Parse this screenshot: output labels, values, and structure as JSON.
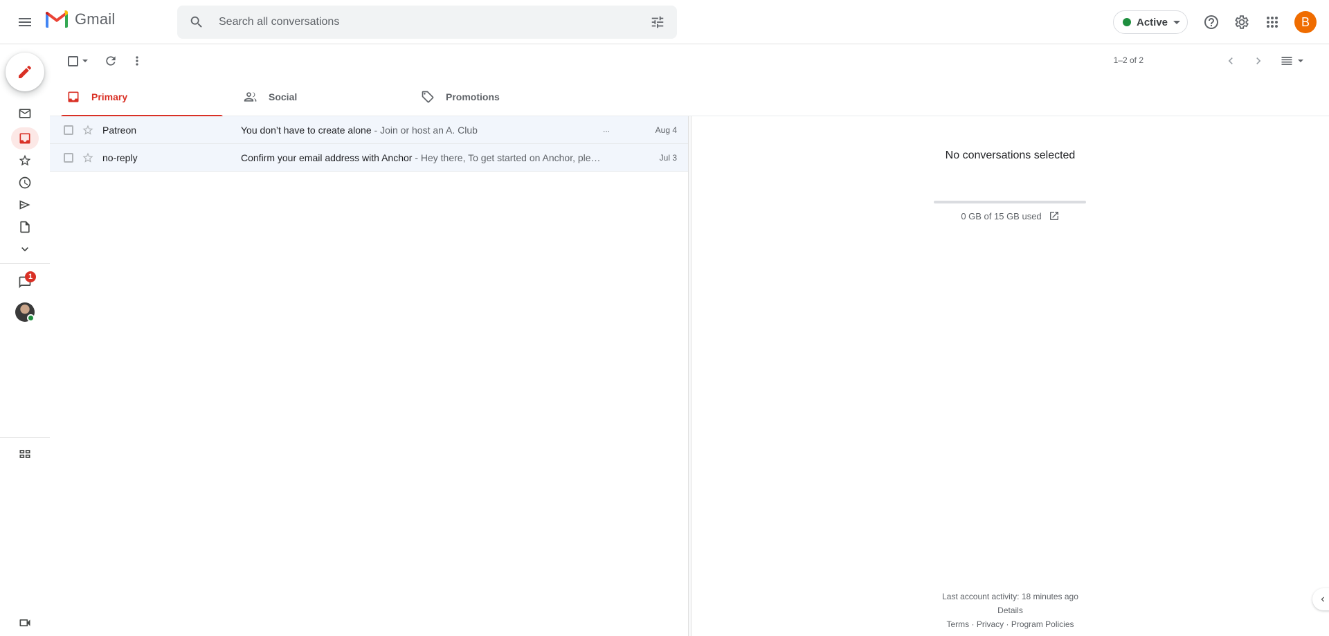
{
  "app": {
    "name": "Gmail",
    "avatar_letter": "B"
  },
  "search": {
    "placeholder": "Search all conversations"
  },
  "status": {
    "label": "Active",
    "color": "#1e8e3e"
  },
  "toolbar": {
    "pagination": "1–2 of 2"
  },
  "tabs": [
    {
      "label": "Primary",
      "icon": "inbox-icon",
      "active": true
    },
    {
      "label": "Social",
      "icon": "people-icon",
      "active": false
    },
    {
      "label": "Promotions",
      "icon": "tag-icon",
      "active": false
    }
  ],
  "rail": {
    "chat_badge": "1",
    "icons": [
      "compose-icon",
      "mail-icon",
      "inbox-icon",
      "star-icon",
      "clock-icon",
      "send-icon",
      "draft-icon",
      "chevron-down-icon",
      "chat-icon",
      "spaces-icon",
      "video-icon"
    ]
  },
  "messages": [
    {
      "sender": "Patreon",
      "subject": "You don’t have to create alone",
      "snippet": " - Join or host an A. Club",
      "trailing": "...",
      "date": "Aug 4"
    },
    {
      "sender": "no-reply",
      "subject": "Confirm your email address with Anchor",
      "snippet": " - Hey there, To get started on Anchor, ple…",
      "trailing": "",
      "date": "Jul 3"
    }
  ],
  "reading_pane": {
    "empty_message": "No conversations selected",
    "storage_text": "0 GB of 15 GB used",
    "storage_fraction": 0.0
  },
  "footer": {
    "activity": "Last account activity: 18 minutes ago",
    "details": "Details",
    "terms": "Terms",
    "privacy": "Privacy",
    "policies": "Program Policies",
    "separator": " · "
  },
  "colors": {
    "accent": "#d93025",
    "row_bg": "#f2f6fc",
    "avatar": "#ef6c00"
  }
}
